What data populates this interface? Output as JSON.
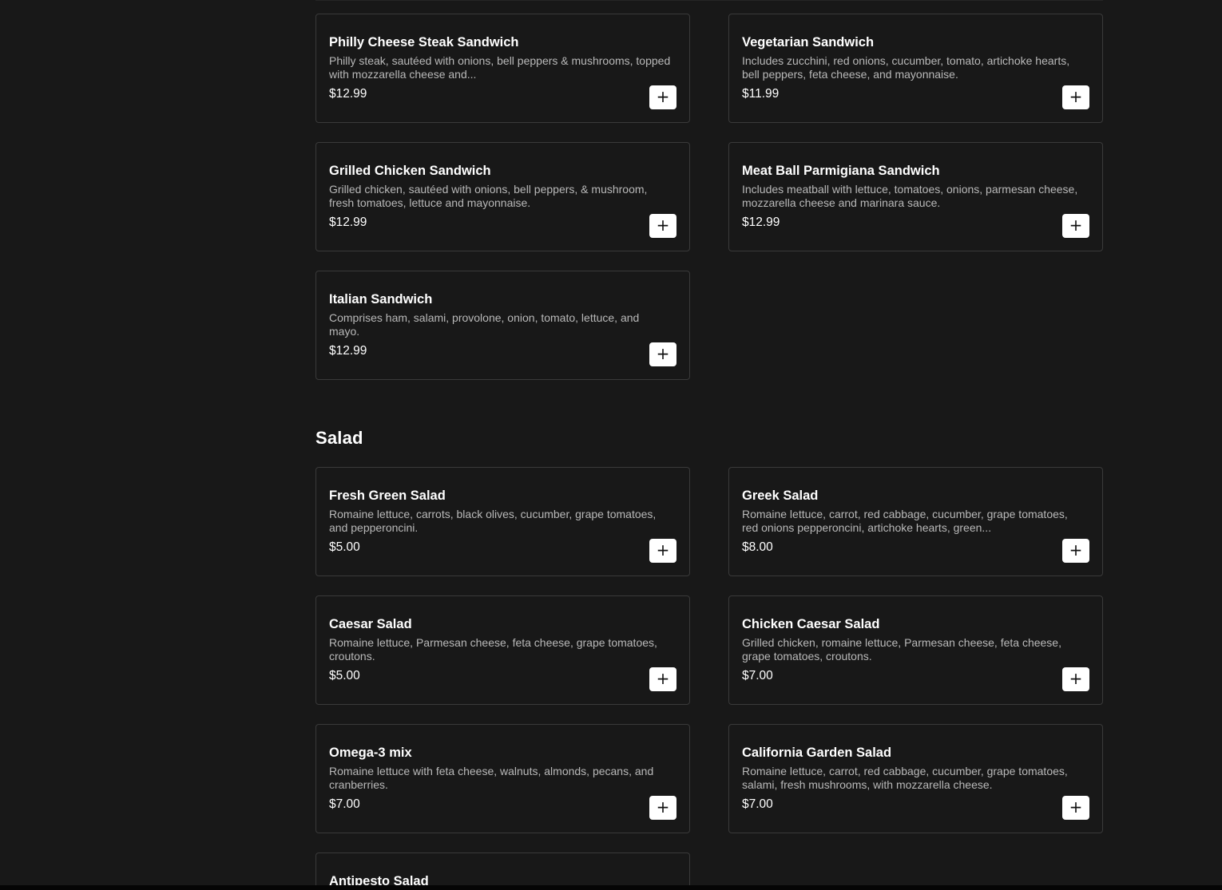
{
  "add_icon": "+",
  "sandwich_items": [
    {
      "name": "Philly Cheese Steak Sandwich",
      "description": "Philly steak, sautéed with onions, bell peppers & mushrooms, topped with mozzarella cheese and...",
      "price": "$12.99"
    },
    {
      "name": "Vegetarian Sandwich",
      "description": "Includes zucchini, red onions, cucumber, tomato, artichoke hearts, bell peppers, feta cheese, and mayonnaise.",
      "price": "$11.99"
    },
    {
      "name": "Grilled Chicken Sandwich",
      "description": "Grilled chicken, sautéed with onions, bell peppers, & mushroom, fresh tomatoes, lettuce and mayonnaise.",
      "price": "$12.99"
    },
    {
      "name": "Meat Ball Parmigiana Sandwich",
      "description": "Includes meatball with lettuce, tomatoes, onions, parmesan cheese, mozzarella cheese and marinara sauce.",
      "price": "$12.99"
    },
    {
      "name": "Italian Sandwich",
      "description": "Comprises ham, salami, provolone, onion, tomato, lettuce, and mayo.",
      "price": "$12.99"
    }
  ],
  "salad_section": {
    "title": "Salad",
    "items": [
      {
        "name": "Fresh Green Salad",
        "description": "Romaine lettuce, carrots, black olives, cucumber, grape tomatoes, and pepperoncini.",
        "price": "$5.00"
      },
      {
        "name": "Greek Salad",
        "description": "Romaine lettuce, carrot, red cabbage, cucumber, grape tomatoes, red onions pepperoncini, artichoke hearts, green...",
        "price": "$8.00"
      },
      {
        "name": "Caesar Salad",
        "description": "Romaine lettuce, Parmesan cheese, feta cheese, grape tomatoes, croutons.",
        "price": "$5.00"
      },
      {
        "name": "Chicken Caesar Salad",
        "description": "Grilled chicken, romaine lettuce, Parmesan cheese, feta cheese, grape tomatoes, croutons.",
        "price": "$7.00"
      },
      {
        "name": "Omega-3 mix",
        "description": "Romaine lettuce with feta cheese, walnuts, almonds, pecans, and cranberries.",
        "price": "$7.00"
      },
      {
        "name": "California Garden Salad",
        "description": "Romaine lettuce, carrot, red cabbage, cucumber, grape tomatoes, salami, fresh mushrooms, with mozzarella cheese.",
        "price": "$7.00"
      }
    ],
    "partial_item": {
      "name": "Antipesto Salad"
    }
  }
}
